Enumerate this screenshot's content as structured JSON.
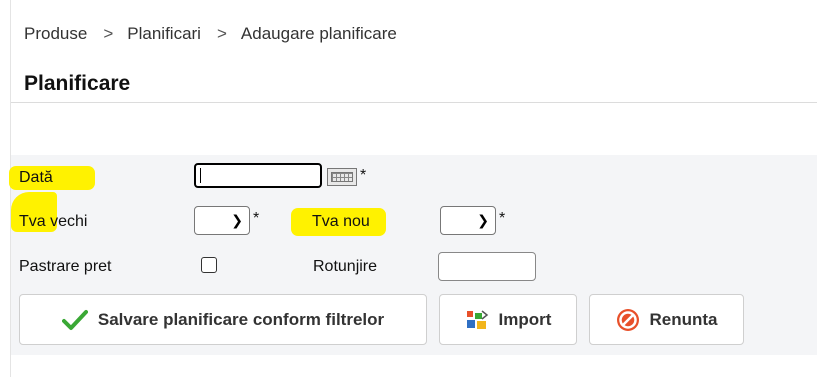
{
  "breadcrumb": {
    "items": [
      "Produse",
      "Planificari",
      "Adaugare planificare"
    ],
    "separator": ">"
  },
  "page": {
    "title": "Planificare"
  },
  "form": {
    "date": {
      "label": "Dată",
      "value": "",
      "required_mark": "*",
      "calendar_icon": "calendar-icon"
    },
    "tva_vechi": {
      "label": "Tva vechi",
      "selected": "",
      "required_mark": "*"
    },
    "tva_nou": {
      "label": "Tva nou",
      "selected": "",
      "required_mark": "*"
    },
    "pastrare_pret": {
      "label": "Pastrare pret",
      "checked": false
    },
    "rotunjire": {
      "label": "Rotunjire",
      "value": ""
    }
  },
  "actions": {
    "save": {
      "label": "Salvare planificare conform filtrelor",
      "icon": "checkmark-icon"
    },
    "import": {
      "label": "Import",
      "icon": "import-icon"
    },
    "cancel": {
      "label": "Renunta",
      "icon": "cancel-icon"
    }
  },
  "colors": {
    "highlight": "#fff200",
    "panel_bg": "#f4f5f7",
    "check_green": "#3aa835",
    "cancel_red": "#e8502a"
  }
}
